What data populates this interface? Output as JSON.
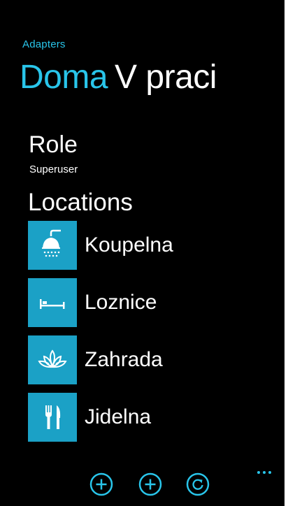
{
  "app": {
    "title": "Adapters"
  },
  "pivot": {
    "items": [
      {
        "label": "Doma",
        "active": true
      },
      {
        "label": "V praci",
        "active": false
      }
    ]
  },
  "role": {
    "heading": "Role",
    "value": "Superuser"
  },
  "locations": {
    "heading": "Locations",
    "items": [
      {
        "label": "Koupelna",
        "icon": "shower-icon"
      },
      {
        "label": "Loznice",
        "icon": "bed-icon"
      },
      {
        "label": "Zahrada",
        "icon": "lotus-icon"
      },
      {
        "label": "Jidelna",
        "icon": "fork-knife-icon"
      }
    ]
  },
  "appbar": {
    "buttons": [
      {
        "icon": "add-icon"
      },
      {
        "icon": "add-icon"
      },
      {
        "icon": "refresh-icon"
      }
    ],
    "more_icon": "ellipsis-icon"
  },
  "colors": {
    "accent": "#29c5ea",
    "tile": "#1ba1c6",
    "background": "#000000",
    "text": "#ffffff"
  }
}
